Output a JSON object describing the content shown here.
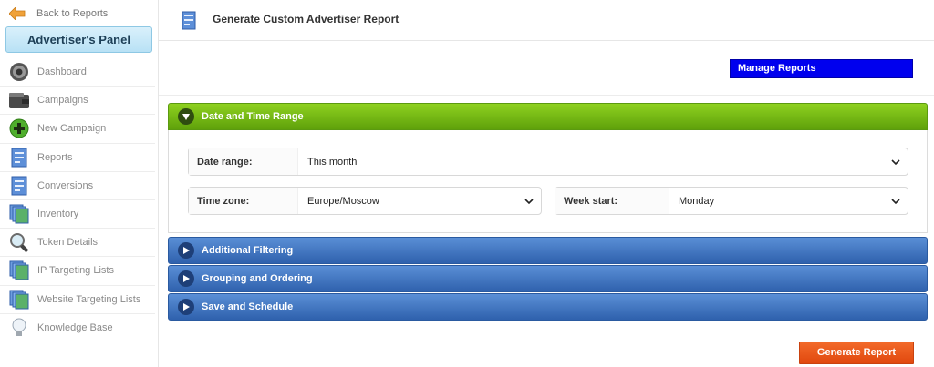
{
  "sidebar": {
    "back_label": "Back to Reports",
    "panel_title": "Advertiser's Panel",
    "items": [
      {
        "label": "Dashboard",
        "icon": "dashboard-icon"
      },
      {
        "label": "Campaigns",
        "icon": "wallet-icon"
      },
      {
        "label": "New Campaign",
        "icon": "plus-circle-icon"
      },
      {
        "label": "Reports",
        "icon": "report-icon"
      },
      {
        "label": "Conversions",
        "icon": "report-icon"
      },
      {
        "label": "Inventory",
        "icon": "stack-icon"
      },
      {
        "label": "Token Details",
        "icon": "magnifier-icon"
      },
      {
        "label": "IP Targeting Lists",
        "icon": "stack-icon"
      },
      {
        "label": "Website Targeting Lists",
        "icon": "stack-icon"
      },
      {
        "label": "Knowledge Base",
        "icon": "lightbulb-icon"
      }
    ]
  },
  "header": {
    "title": "Generate Custom Advertiser Report"
  },
  "toolbar": {
    "manage_label": "Manage Reports",
    "generate_label": "Generate Report"
  },
  "sections": {
    "date_time": "Date and Time Range",
    "filtering": "Additional Filtering",
    "grouping": "Grouping and Ordering",
    "save": "Save and Schedule"
  },
  "form": {
    "date_range_label": "Date range:",
    "date_range_value": "This month",
    "time_zone_label": "Time zone:",
    "time_zone_value": "Europe/Moscow",
    "week_start_label": "Week start:",
    "week_start_value": "Monday"
  },
  "colors": {
    "section_green": "#6cb014",
    "section_blue": "#3a6fbf",
    "manage_button": "#0000ee",
    "generate_button": "#e8561a",
    "panel_header": "#c6e8f8"
  }
}
